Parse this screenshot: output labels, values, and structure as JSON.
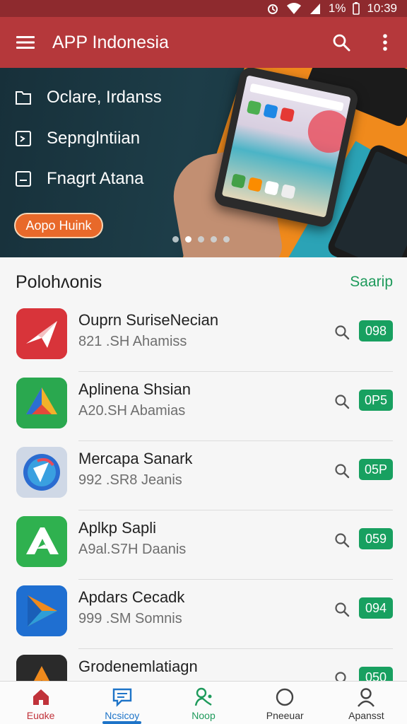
{
  "status_bar": {
    "battery": "1%",
    "time": "10:39"
  },
  "app_bar": {
    "title": "APP Indonesia",
    "icons": [
      "menu-icon",
      "search-icon",
      "more-vert-icon"
    ]
  },
  "banner": {
    "items": [
      {
        "label": "Oclare, Irdanss",
        "icon": "folder-icon"
      },
      {
        "label": "Sepnglntiian",
        "icon": "shield-icon"
      },
      {
        "label": "Fnagrt Atana",
        "icon": "square-icon"
      }
    ],
    "cta": "Aopo Huink",
    "dots": {
      "count": 5,
      "active": 1
    }
  },
  "section": {
    "title": "Polohʌonis",
    "action": "Saarip"
  },
  "apps": [
    {
      "name": "Ouprn SuriseNecian",
      "meta": "821 .SH Ahamiss",
      "badge": "098",
      "icon": "red-plane-app-icon",
      "color": "#d8343a"
    },
    {
      "name": "Aplinena Shsian",
      "meta": "A20.SH Abamias",
      "badge": "0P5",
      "icon": "green-triangle-app-icon",
      "color": "#2aa84f"
    },
    {
      "name": "Mercapa Sanark",
      "meta": "992 .SR8 Jeanis",
      "badge": "05P",
      "icon": "blue-circle-app-icon",
      "color": "#2b6cd0"
    },
    {
      "name": "Aplkp Sapli",
      "meta": "A9al.S7H Daanis",
      "badge": "059",
      "icon": "green-arrow-app-icon",
      "color": "#2fb14f"
    },
    {
      "name": "Apdars Cecadk",
      "meta": "999 .SM Somnis",
      "badge": "094",
      "icon": "blue-orange-app-icon",
      "color": "#1f6fd1"
    },
    {
      "name": "Grodenemlatiagn",
      "meta": "",
      "badge": "050",
      "icon": "dark-orange-app-icon",
      "color": "#2a2a2a"
    }
  ],
  "bottom_nav": [
    {
      "label": "Euɑke",
      "icon": "home-icon"
    },
    {
      "label": "Ncsicoy",
      "icon": "message-icon"
    },
    {
      "label": "Noop",
      "icon": "person-route-icon"
    },
    {
      "label": "Pneeuar",
      "icon": "circle-icon"
    },
    {
      "label": "Apansst",
      "icon": "account-icon"
    }
  ]
}
